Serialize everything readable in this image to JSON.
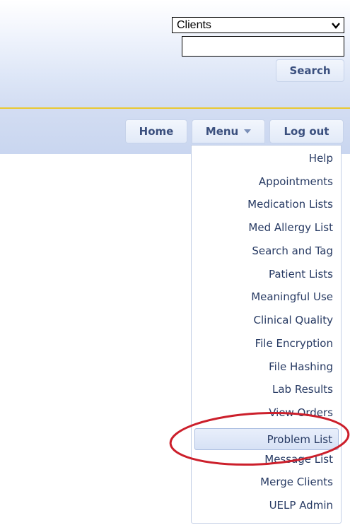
{
  "search": {
    "scope_selected": "Clients",
    "query_value": "",
    "button_label": "Search"
  },
  "nav": {
    "home_label": "Home",
    "menu_label": "Menu",
    "logout_label": "Log out"
  },
  "menu": {
    "items": [
      {
        "label": "Help"
      },
      {
        "label": "Appointments"
      },
      {
        "label": "Medication Lists"
      },
      {
        "label": "Med Allergy List"
      },
      {
        "label": "Search and Tag"
      },
      {
        "label": "Patient Lists"
      },
      {
        "label": "Meaningful Use"
      },
      {
        "label": "Clinical Quality"
      },
      {
        "label": "File Encryption"
      },
      {
        "label": "File Hashing"
      },
      {
        "label": "Lab Results"
      },
      {
        "label": "View Orders"
      },
      {
        "label": "Problem List",
        "highlighted": true
      },
      {
        "label": "Message List"
      },
      {
        "label": "Merge Clients"
      },
      {
        "label": "UELP Admin"
      }
    ]
  },
  "colors": {
    "header_top": "#ffffff",
    "header_bottom": "#c9d6f0",
    "rule": "#e9c832",
    "button_text": "#3a4f7e",
    "menu_text": "#273a63",
    "annotation": "#cc1f2b"
  },
  "icons": {
    "select_chevron": "chevron-down-icon",
    "menu_caret": "caret-down-icon"
  }
}
